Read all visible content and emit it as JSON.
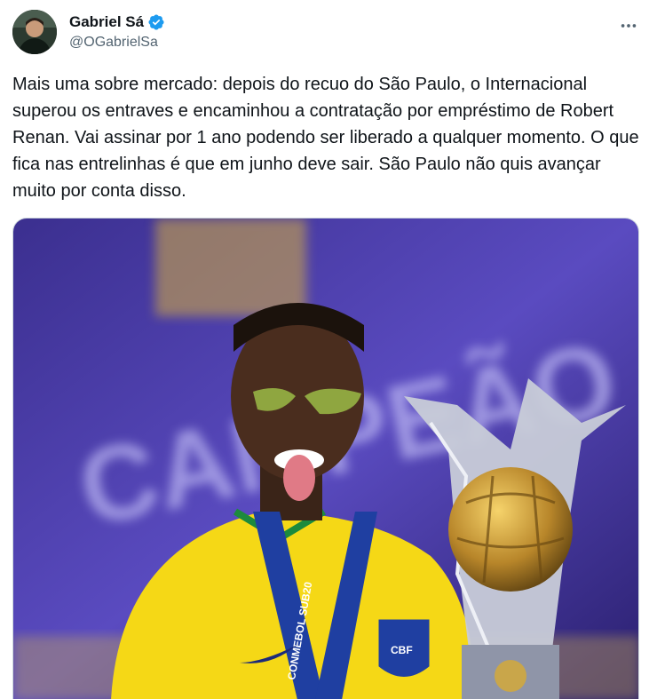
{
  "author": {
    "display_name": "Gabriel Sá",
    "handle": "@OGabrielSa",
    "verified": true,
    "verified_color": "#1d9bf0"
  },
  "tweet": {
    "text": "Mais uma sobre mercado: depois do recuo do São Paulo, o Internacional superou os entraves e encaminhou a contratação por empréstimo de Robert Renan. Vai assinar por 1 ano podendo ser liberado a qualquer momento. O que fica nas entrelinhas é que em junho deve sair. São Paulo não quis avançar muito por conta disso."
  },
  "media": {
    "background_text": "CAMPEÃO",
    "medal_ribbon_text": "CONMEBOL SUB20",
    "crest_text": "CBF"
  },
  "icons": {
    "more": "more-horizontal-icon",
    "verified": "verified-badge-icon"
  }
}
